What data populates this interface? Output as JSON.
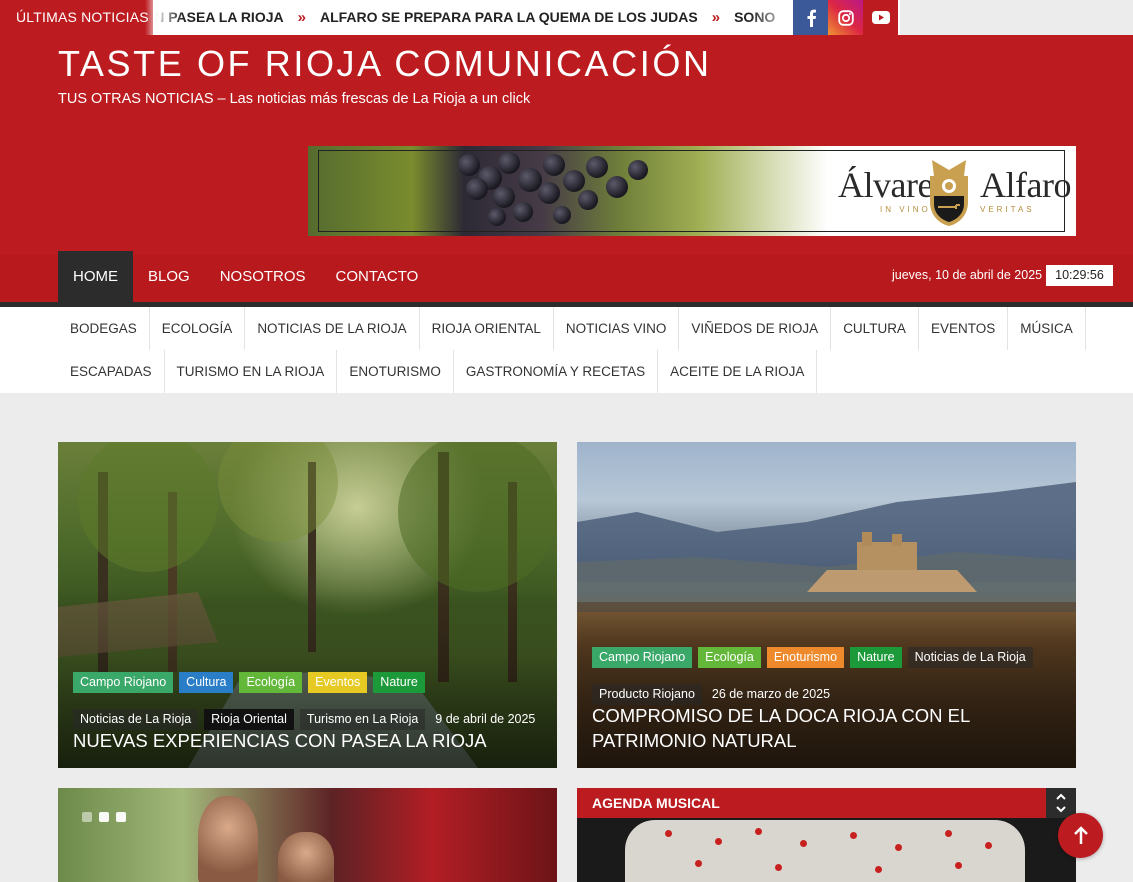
{
  "ticker": {
    "label": "ÚLTIMAS NOTICIAS",
    "items": [
      "S CON PASEA LA RIOJA",
      "ALFARO SE PREPARA PARA LA QUEMA DE LOS JUDAS",
      "SONO"
    ],
    "separator": "»"
  },
  "social": {
    "icons": [
      "facebook-icon",
      "instagram-icon",
      "youtube-icon"
    ]
  },
  "header": {
    "title": "TASTE OF RIOJA COMUNICACIÓN",
    "description": "TUS OTRAS NOTICIAS – Las noticias más frescas de La Rioja a un click"
  },
  "banner": {
    "brand_left": "Álvarez",
    "brand_right": "Alfaro",
    "motto_left": "IN VINO",
    "motto_right": "VERITAS"
  },
  "nav": {
    "items": [
      "HOME",
      "BLOG",
      "NOSOTROS",
      "CONTACTO"
    ],
    "date": "jueves, 10 de abril de 2025",
    "time": "10:29:56"
  },
  "categories": {
    "row1": [
      "BODEGAS",
      "ECOLOGÍA",
      "NOTICIAS DE LA RIOJA",
      "RIOJA ORIENTAL",
      "NOTICIAS VINO",
      "VIÑEDOS DE RIOJA",
      "CULTURA",
      "EVENTOS",
      "MÚSICA"
    ],
    "row2": [
      "ESCAPADAS",
      "TURISMO EN LA RIOJA",
      "ENOTURISMO",
      "GASTRONOMÍA Y RECETAS",
      "ACEITE DE LA RIOJA"
    ]
  },
  "posts": [
    {
      "tags": [
        "Campo Riojano",
        "Cultura",
        "Ecología",
        "Eventos",
        "Nature",
        "Noticias de La Rioja",
        "Rioja Oriental",
        "Turismo en La Rioja"
      ],
      "date": "9 de abril de 2025",
      "title": "NUEVAS EXPERIENCIAS CON PASEA LA RIOJA"
    },
    {
      "tags": [
        "Campo Riojano",
        "Ecología",
        "Enoturismo",
        "Nature",
        "Noticias de La Rioja",
        "Producto Riojano"
      ],
      "date": "26 de marzo de 2025",
      "title": "COMPROMISO DE LA DOCA RIOJA CON EL PATRIMONIO NATURAL"
    }
  ],
  "agenda": {
    "title": "AGENDA MUSICAL"
  },
  "colors": {
    "brand_red": "#bc1b1f",
    "dark": "#2c2c2c"
  }
}
